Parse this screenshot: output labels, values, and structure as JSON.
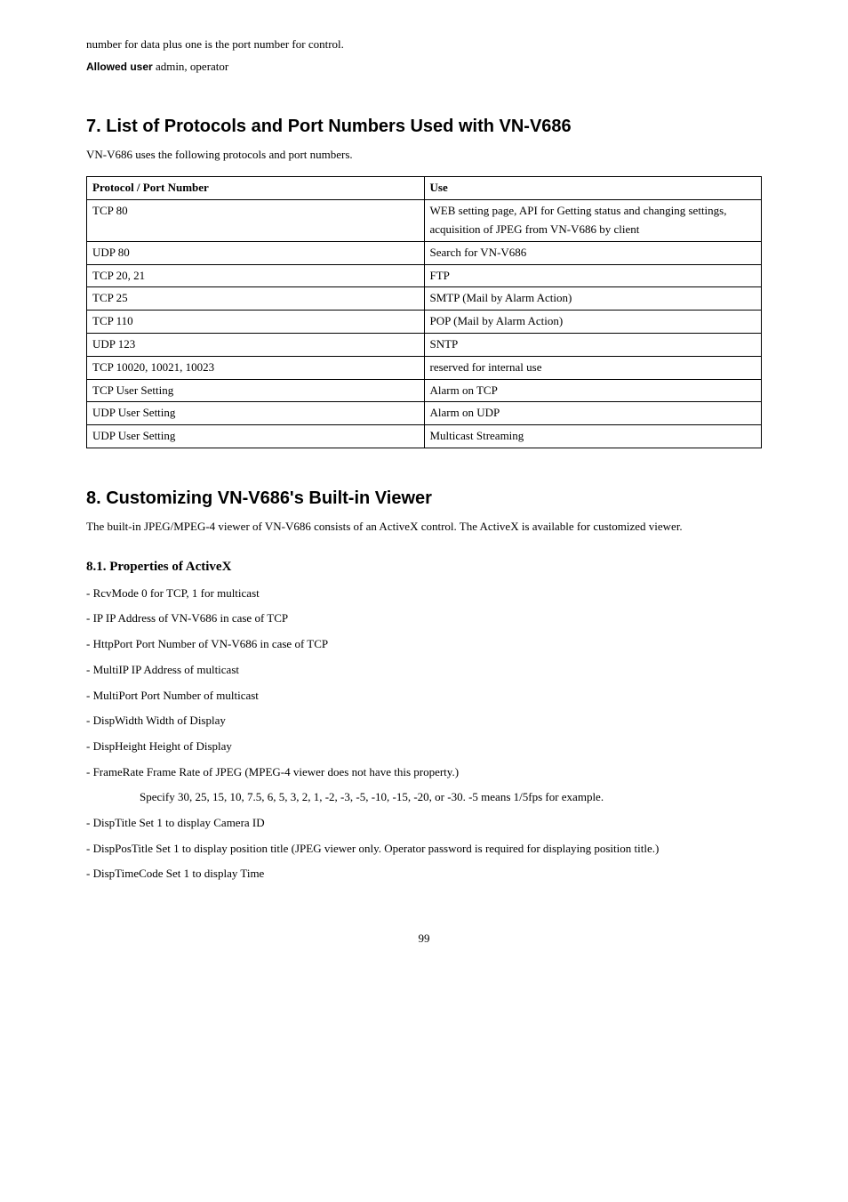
{
  "intro_line": "number for data plus one is the port number for control.",
  "allowed_user_label": "Allowed user",
  "allowed_user_value": "  admin, operator",
  "section7": {
    "heading": "7. List of Protocols and Port Numbers Used with VN-V686",
    "subtext": "VN-V686 uses the following protocols and port numbers.",
    "th1": "Protocol / Port Number",
    "th2": "Use",
    "rows": [
      {
        "c1": "TCP  80",
        "c2": "WEB setting page, API for Getting status and changing settings, acquisition of JPEG from VN-V686 by client"
      },
      {
        "c1": "UDP  80",
        "c2": "Search for VN-V686"
      },
      {
        "c1": "TCP  20, 21",
        "c2": "FTP"
      },
      {
        "c1": "TCP  25",
        "c2": "SMTP (Mail by Alarm Action)"
      },
      {
        "c1": "TCP  110",
        "c2": "POP (Mail by Alarm Action)"
      },
      {
        "c1": "UDP  123",
        "c2": "SNTP"
      },
      {
        "c1": "TCP  10020, 10021, 10023",
        "c2": "reserved for internal use"
      },
      {
        "c1": "TCP  User Setting",
        "c2": "Alarm on TCP"
      },
      {
        "c1": "UDP  User Setting",
        "c2": "Alarm on UDP"
      },
      {
        "c1": "UDP  User Setting",
        "c2": "Multicast Streaming"
      }
    ]
  },
  "section8": {
    "heading": "8. Customizing VN-V686's Built-in Viewer",
    "subtext": "The built-in JPEG/MPEG-4 viewer of VN-V686 consists of an ActiveX control. The ActiveX is available for customized viewer.",
    "sub81": "8.1. Properties of ActiveX",
    "props": [
      "  - RcvMode        0 for TCP, 1 for multicast",
      "  - IP         IP Address of VN-V686 in case of TCP",
      "  - HttpPort      Port Number of VN-V686 in case of TCP",
      "  - MultiIP       IP Address of multicast",
      "  - MultiPort      Port Number of multicast",
      "  - DispWidth   Width of Display",
      "  - DispHeight   Height of Display",
      "  - FrameRate  Frame Rate of JPEG  (MPEG-4 viewer does not have this property.)"
    ],
    "framerate_detail": "Specify 30, 25, 15, 10, 7.5, 6, 5, 3, 2, 1, -2, -3, -5, -10, -15, -20, or -30.  -5 means 1/5fps for example.",
    "props2": [
      "  - DispTitle    Set 1 to display Camera ID",
      "  - DispPosTitle    Set 1 to display position title  (JPEG viewer only. Operator password is required for displaying position title.)",
      "  - DispTimeCode    Set 1 to display Time"
    ]
  },
  "page_number": "99"
}
